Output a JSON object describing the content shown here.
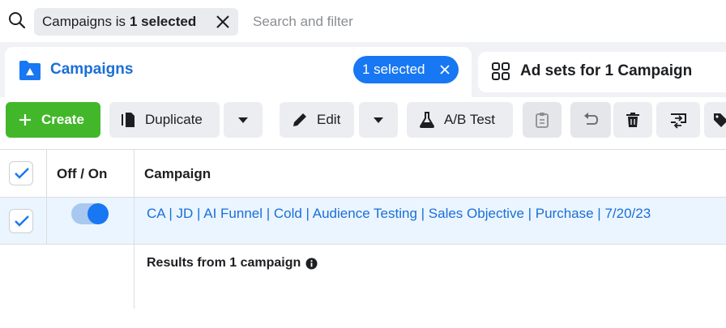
{
  "search": {
    "filter_chip_prefix": "Campaigns is",
    "filter_chip_value": "1 selected",
    "placeholder": "Search and filter"
  },
  "tabs": {
    "campaigns_label": "Campaigns",
    "selected_pill": "1 selected",
    "adsets_label": "Ad sets for 1 Campaign"
  },
  "toolbar": {
    "create_label": "Create",
    "duplicate_label": "Duplicate",
    "edit_label": "Edit",
    "abtest_label": "A/B Test"
  },
  "table": {
    "columns": [
      "Off / On",
      "Campaign"
    ],
    "rows": [
      {
        "name": "CA | JD | AI Funnel | Cold | Audience Testing | Sales Objective | Purchase | 7/20/23",
        "enabled": true,
        "selected": true
      }
    ],
    "results_label": "Results from 1 campaign"
  },
  "colors": {
    "primary_blue": "#1877f2",
    "create_green": "#42b72a",
    "link_blue": "#1a6fd6",
    "selected_row": "#ebf5ff"
  }
}
